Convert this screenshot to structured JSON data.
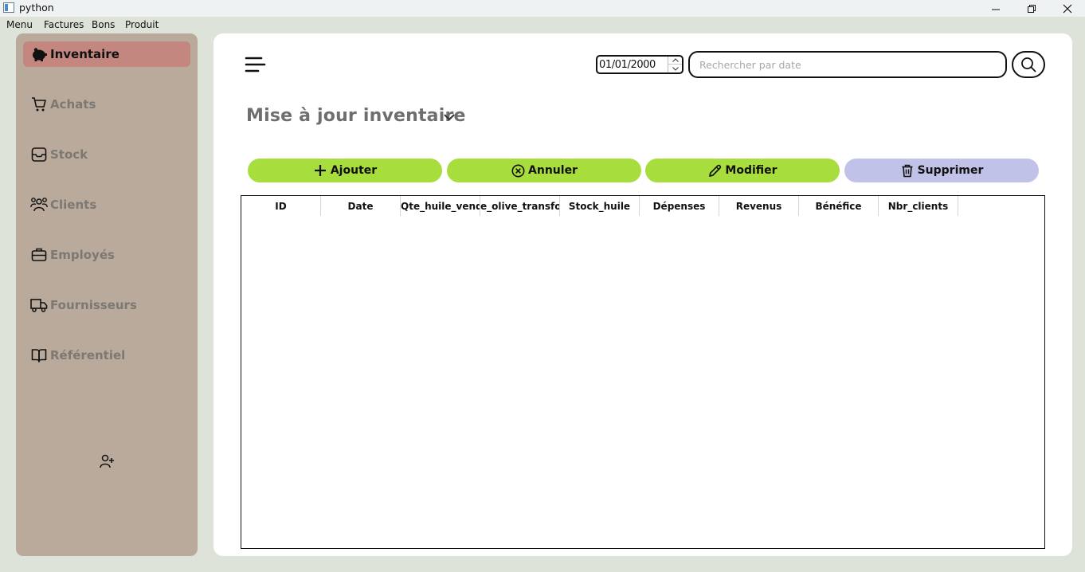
{
  "window": {
    "title": "python"
  },
  "menubar": {
    "items": [
      "Menu",
      "Factures",
      "Bons",
      "Produit"
    ]
  },
  "sidebar": {
    "items": [
      {
        "label": "Inventaire",
        "icon": "piggy-bank-icon",
        "active": true
      },
      {
        "label": "Achats",
        "icon": "cart-icon",
        "active": false
      },
      {
        "label": "Stock",
        "icon": "storage-box-icon",
        "active": false
      },
      {
        "label": "Clients",
        "icon": "users-icon",
        "active": false
      },
      {
        "label": "Employés",
        "icon": "briefcase-icon",
        "active": false
      },
      {
        "label": "Fournisseurs",
        "icon": "truck-icon",
        "active": false
      },
      {
        "label": "Référentiel",
        "icon": "book-icon",
        "active": false
      }
    ],
    "footer_icon": "add-user-icon"
  },
  "toolbar": {
    "date_value": "01/01/2000",
    "search_placeholder": "Rechercher par date"
  },
  "main": {
    "title": "Mise à jour inventaire",
    "actions": [
      {
        "label": "Ajouter",
        "icon": "plus-icon"
      },
      {
        "label": "Annuler",
        "icon": "cancel-circle-icon"
      },
      {
        "label": "Modifier",
        "icon": "pencil-icon"
      },
      {
        "label": "Supprimer",
        "icon": "trash-icon"
      }
    ]
  },
  "table": {
    "columns": [
      "ID",
      "Date",
      "Qte_huile_vendu",
      "e_olive_transfor",
      "Stock_huile",
      "Dépenses",
      "Revenus",
      "Bénéfice",
      "Nbr_clients"
    ],
    "rows": []
  },
  "colors": {
    "sidebar_bg": "#baaa9b",
    "active_item": "#c4877f",
    "action_button": "#a7dd3d",
    "delete_button": "#c1c2e8",
    "window_bg": "#dde3d8"
  }
}
